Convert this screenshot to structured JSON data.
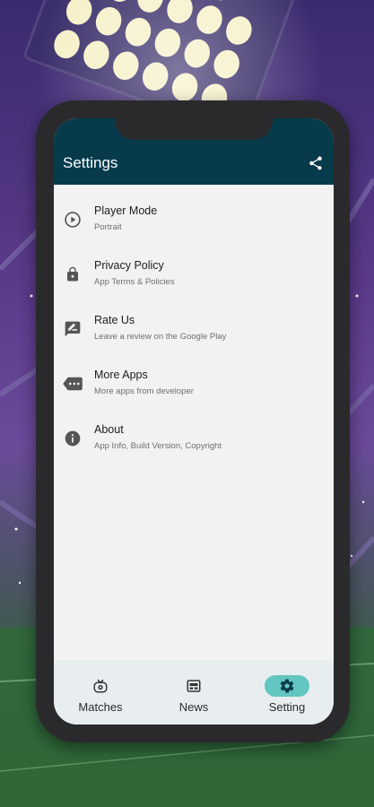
{
  "app": {
    "title": "Settings"
  },
  "appbar": {
    "share_icon": "share-icon"
  },
  "settings": {
    "items": [
      {
        "title": "Player Mode",
        "subtitle": "Portrait",
        "icon": "play-circle-icon"
      },
      {
        "title": "Privacy Policy",
        "subtitle": "App Terms & Policies",
        "icon": "lock-icon"
      },
      {
        "title": "Rate Us",
        "subtitle": "Leave a review on the Google Play",
        "icon": "rate-review-icon"
      },
      {
        "title": "More Apps",
        "subtitle": "More apps from developer",
        "icon": "more-apps-icon"
      },
      {
        "title": "About",
        "subtitle": "App Info, Build Version, Copyright",
        "icon": "info-icon"
      }
    ]
  },
  "bottom_nav": {
    "items": [
      {
        "label": "Matches",
        "icon": "tv-icon",
        "active": false
      },
      {
        "label": "News",
        "icon": "news-icon",
        "active": false
      },
      {
        "label": "Setting",
        "icon": "gear-icon",
        "active": true
      }
    ]
  },
  "colors": {
    "appbar": "#073b4c",
    "active_pill": "#64c6c0",
    "screen_bg": "#f2f2f2"
  }
}
